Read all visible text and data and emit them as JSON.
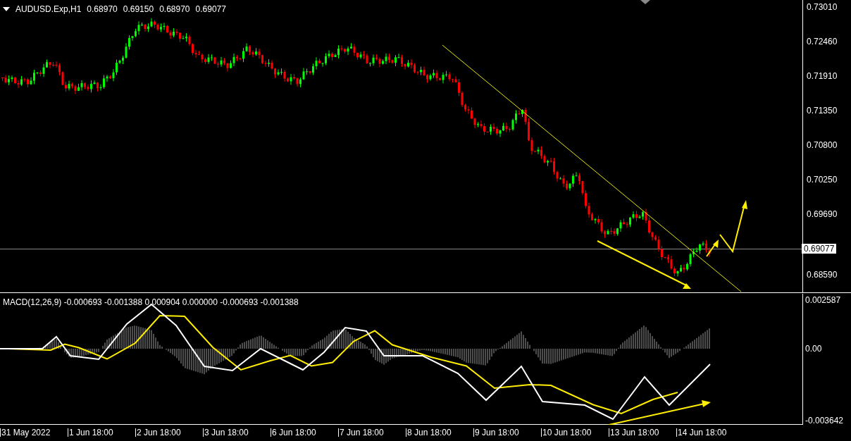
{
  "header": {
    "symbol": "AUDUSD.Exp,H1",
    "ohlc": [
      "0.68970",
      "0.69150",
      "0.68970",
      "0.69077"
    ]
  },
  "price_axis": [
    "0.73010",
    "0.72460",
    "0.71910",
    "0.71350",
    "0.70800",
    "0.70250",
    "0.69690",
    "0.68590"
  ],
  "current_price": "0.69077",
  "macd": {
    "label": "MACD(12,26,9) -0.000693 -0.001388 0.000904 0.000000 -0.000693 -0.001388",
    "axis": [
      "0.002587",
      "0.00",
      "-0.003642"
    ]
  },
  "time_axis": [
    "31 May 2022",
    "1 Jun 18:00",
    "2 Jun 18:00",
    "3 Jun 18:00",
    "6 Jun 18:00",
    "7 Jun 18:00",
    "8 Jun 18:00",
    "9 Jun 18:00",
    "10 Jun 18:00",
    "13 Jun 18:00",
    "14 Jun 18:00"
  ]
}
